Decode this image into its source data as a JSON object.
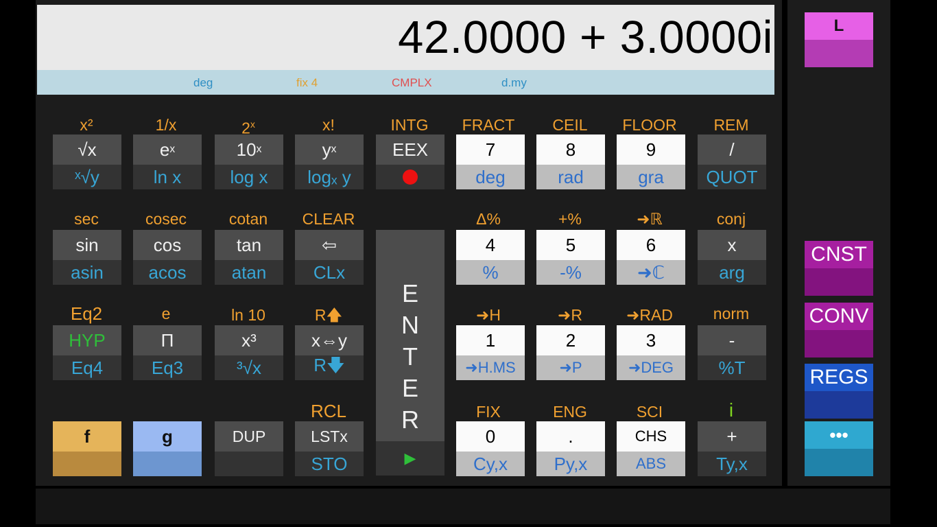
{
  "display": {
    "value": "42.0000 + 3.0000i",
    "status": [
      {
        "text": "deg",
        "color": "#2f8fc4"
      },
      {
        "text": "fix 4",
        "color": "#e0a030"
      },
      {
        "text": "CMPLX",
        "color": "#e05050"
      },
      {
        "text": "d.my",
        "color": "#2f8fc4"
      }
    ]
  },
  "labels": {
    "r1": [
      "x²",
      "1/x",
      "2",
      "x!",
      "INTG",
      "FRACT",
      "CEIL",
      "FLOOR",
      "REM"
    ],
    "r1_sup": [
      "",
      "",
      "x",
      "",
      "",
      "",
      "",
      "",
      ""
    ],
    "r2": [
      "sec",
      "cosec",
      "cotan",
      "CLEAR",
      "",
      "Δ%",
      "+%",
      "➜ℝ",
      "conj"
    ],
    "r3": [
      "Eq2",
      "e",
      "ln 10",
      "R🡅",
      "",
      "➜H",
      "➜R",
      "➜RAD",
      "norm"
    ],
    "r4": [
      "",
      "",
      "",
      "RCL",
      "",
      "FIX",
      "ENG",
      "SCI",
      "i"
    ]
  },
  "keys": {
    "sqrt": {
      "top": "√x",
      "bot": "ˣ√y"
    },
    "exp": {
      "top": "e",
      "top_sup": "x",
      "bot": "ln x"
    },
    "pow10": {
      "top": "10",
      "top_sup": "x",
      "bot": "log x"
    },
    "powy": {
      "top": "y",
      "top_sup": "x",
      "bot": "logₓ y"
    },
    "eex": {
      "top": "EEX"
    },
    "d7": {
      "top": "7",
      "bot": "deg"
    },
    "d8": {
      "top": "8",
      "bot": "rad"
    },
    "d9": {
      "top": "9",
      "bot": "gra"
    },
    "div": {
      "top": "/",
      "bot": "QUOT"
    },
    "sin": {
      "top": "sin",
      "bot": "asin"
    },
    "cos": {
      "top": "cos",
      "bot": "acos"
    },
    "tan": {
      "top": "tan",
      "bot": "atan"
    },
    "back": {
      "top": "⇦",
      "bot": "CLx"
    },
    "d4": {
      "top": "4",
      "bot": "%"
    },
    "d5": {
      "top": "5",
      "bot": "-%"
    },
    "d6": {
      "top": "6",
      "bot": "➜ℂ"
    },
    "mul": {
      "top": "x",
      "bot": "arg"
    },
    "hyp": {
      "top": "HYP",
      "bot": "Eq4"
    },
    "pi": {
      "top": "Π",
      "bot": "Eq3"
    },
    "cube": {
      "top": "x³",
      "bot": "³√x"
    },
    "swap": {
      "top": "x⇔y",
      "bot": "R🡇"
    },
    "d1": {
      "top": "1",
      "bot": "➜H.MS"
    },
    "d2": {
      "top": "2",
      "bot": "➜P"
    },
    "d3": {
      "top": "3",
      "bot": "➜DEG"
    },
    "sub": {
      "top": "-",
      "bot": "%T"
    },
    "f": {
      "top": "f"
    },
    "g": {
      "top": "g"
    },
    "dup": {
      "top": "DUP"
    },
    "lstx": {
      "top": "LSTx",
      "bot": "STO"
    },
    "d0": {
      "top": "0",
      "bot": "Cy,x"
    },
    "dot": {
      "top": ".",
      "bot": "Py,x"
    },
    "chs": {
      "top": "CHS",
      "bot": "ABS"
    },
    "add": {
      "top": "+",
      "bot": "Ty,x"
    }
  },
  "enter": {
    "letters": [
      "E",
      "N",
      "T",
      "E",
      "R"
    ],
    "arrow": "▶"
  },
  "side": [
    {
      "label": "L",
      "color_top": "#e660e6",
      "color_bot": "#b43cb4"
    },
    {
      "label": "CNST",
      "color_top": "#a61fa0",
      "color_bot": "#83137f"
    },
    {
      "label": "CONV",
      "color_top": "#a61fa0",
      "color_bot": "#83137f"
    },
    {
      "label": "REGS",
      "color_top": "#1e57c8",
      "color_bot": "#1d3a9a"
    },
    {
      "label": "•••",
      "color_top": "#2fa8d0",
      "color_bot": "#2083aa"
    }
  ]
}
